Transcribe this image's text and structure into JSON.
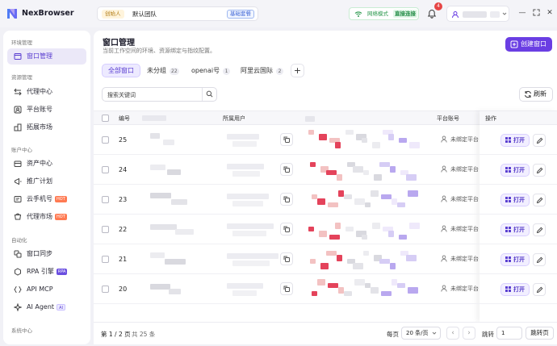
{
  "app": {
    "name": "NexBrowser"
  },
  "team": {
    "role_badge": "创始人",
    "name": "默认团队",
    "plan": "基础套餐"
  },
  "network": {
    "mode": "网络模式",
    "direct": "直接连接"
  },
  "notifications": {
    "count": "4"
  },
  "sidebar": {
    "sections": [
      {
        "title": "环境管理",
        "items": [
          {
            "label": "窗口管理",
            "icon": "window-icon",
            "active": true
          }
        ]
      },
      {
        "title": "资源管理",
        "items": [
          {
            "label": "代理中心",
            "icon": "proxy-icon"
          },
          {
            "label": "平台账号",
            "icon": "account-icon"
          },
          {
            "label": "拓展市场",
            "icon": "extension-icon"
          }
        ]
      },
      {
        "title": "账户中心",
        "items": [
          {
            "label": "资产中心",
            "icon": "asset-icon"
          },
          {
            "label": "推广计划",
            "icon": "promo-icon"
          },
          {
            "label": "云手机号",
            "icon": "phone-icon",
            "tag": "HOT"
          },
          {
            "label": "代理市场",
            "icon": "market-icon",
            "tag": "HOT"
          }
        ]
      },
      {
        "title": "自动化",
        "items": [
          {
            "label": "窗口同步",
            "icon": "sync-icon"
          },
          {
            "label": "RPA 引擎",
            "icon": "rpa-icon",
            "tag": "RPA"
          },
          {
            "label": "API MCP",
            "icon": "api-icon"
          },
          {
            "label": "AI Agent",
            "icon": "ai-icon",
            "tag": "AI"
          }
        ]
      },
      {
        "title": "系统中心",
        "items": []
      }
    ]
  },
  "page": {
    "title": "窗口管理",
    "subtitle": "当前工作空间的环境、资源绑定与指纹配置。",
    "create_button": "创建窗口",
    "tabs": [
      {
        "label": "全部窗口",
        "count": ""
      },
      {
        "label": "未分组",
        "count": "22"
      },
      {
        "label": "openai号",
        "count": "1"
      },
      {
        "label": "阿里云国际",
        "count": "2"
      }
    ],
    "search_placeholder": "搜索关键词",
    "refresh_button": "刷新"
  },
  "table": {
    "columns": [
      "编号",
      "所属用户",
      "平台账号",
      "操作"
    ],
    "rows": [
      {
        "id": "25",
        "platform": "未绑定平台",
        "open": "打开"
      },
      {
        "id": "24",
        "platform": "未绑定平台",
        "open": "打开"
      },
      {
        "id": "23",
        "platform": "未绑定平台",
        "open": "打开"
      },
      {
        "id": "22",
        "platform": "未绑定平台",
        "open": "打开"
      },
      {
        "id": "21",
        "platform": "未绑定平台",
        "open": "打开"
      },
      {
        "id": "20",
        "platform": "未绑定平台",
        "open": "打开"
      }
    ]
  },
  "pagination": {
    "page_info": "第 1 / 2 页",
    "total": "共 25 条",
    "per_page_label": "每页",
    "per_page_value": "20  条/页",
    "jump_label": "跳转",
    "jump_value": "1",
    "jump_button": "跳转页"
  },
  "colors": {
    "accent": "#6a3ee3",
    "accent_light": "#edeaff",
    "success": "#2e9a50",
    "danger": "#e64545"
  }
}
